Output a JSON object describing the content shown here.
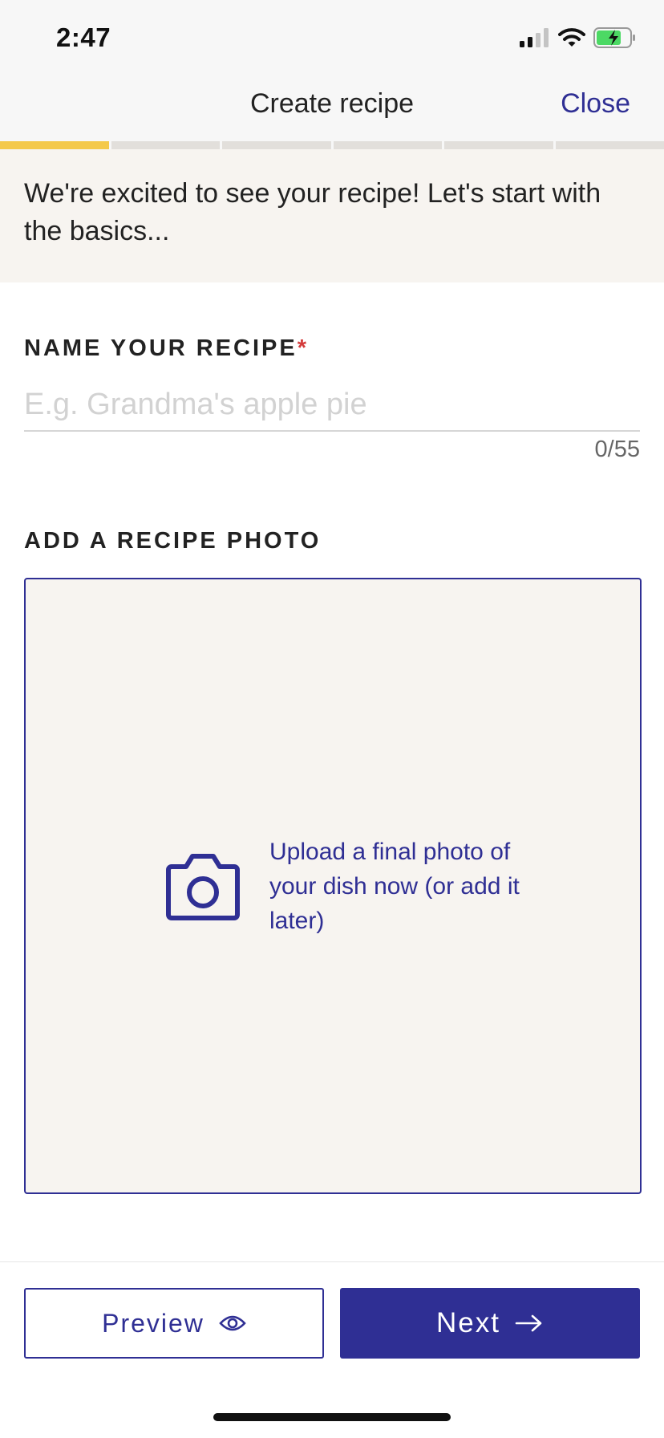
{
  "status_bar": {
    "time": "2:47",
    "icons": [
      "signal-icon",
      "wifi-icon",
      "battery-charging-icon"
    ]
  },
  "header": {
    "title": "Create recipe",
    "close_label": "Close"
  },
  "progress": {
    "total_steps": 6,
    "current_step": 1,
    "active_color": "#f4c94a",
    "inactive_color": "#e2dfdb"
  },
  "banner": {
    "text": "We're excited to see your recipe! Let's start with the basics..."
  },
  "name_field": {
    "label": "NAME YOUR RECIPE",
    "required_marker": "*",
    "placeholder": "E.g. Grandma's apple pie",
    "value": "",
    "counter": "0/55"
  },
  "photo": {
    "label": "ADD A RECIPE PHOTO",
    "upload_text": "Upload a final photo of your dish now (or add it later)",
    "icon": "camera-icon"
  },
  "footer": {
    "preview_label": "Preview",
    "preview_icon": "eye-icon",
    "next_label": "Next",
    "next_icon": "arrow-right-icon"
  },
  "colors": {
    "accent": "#2f2f94",
    "banner_bg": "#f7f4f0",
    "required": "#d33b3b"
  }
}
